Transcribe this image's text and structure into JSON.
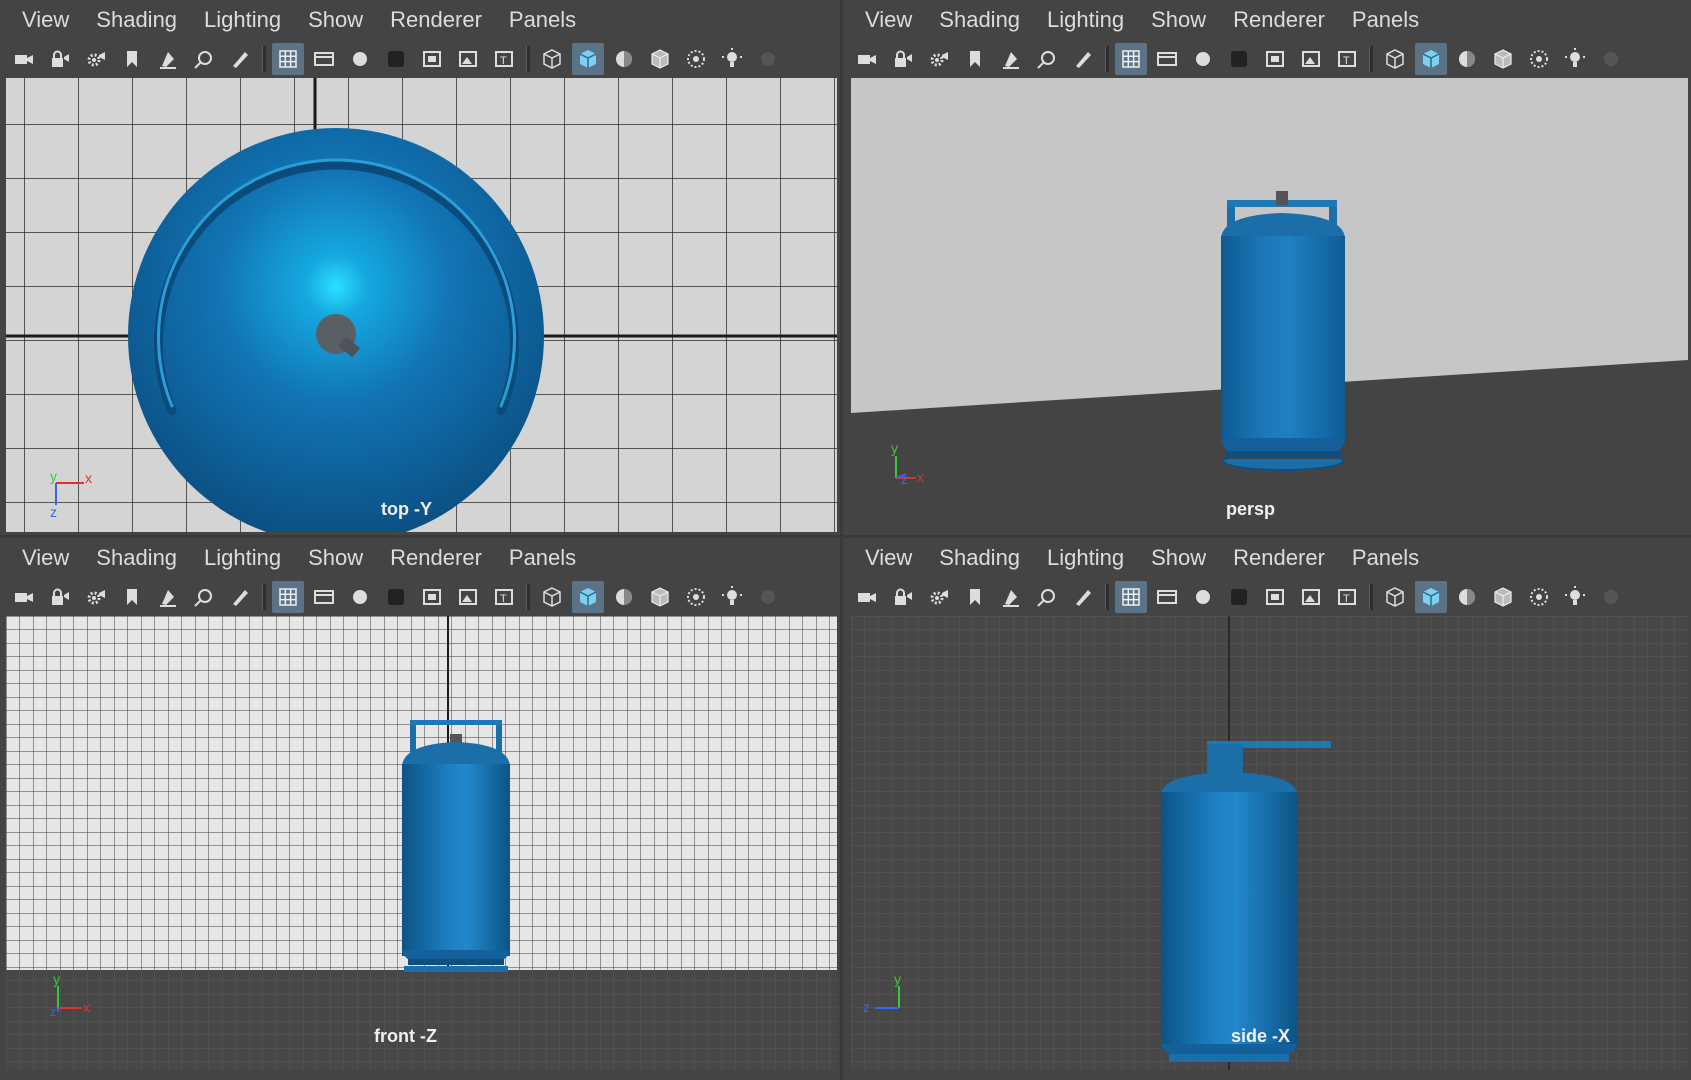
{
  "menus": [
    "View",
    "Shading",
    "Lighting",
    "Show",
    "Renderer",
    "Panels"
  ],
  "toolbar_icons": [
    "camera-icon",
    "lock-camera-icon",
    "camera-attributes-icon",
    "bookmark-icon",
    "image-plane-icon",
    "2d-pan-zoom-icon",
    "grease-pencil-icon",
    "|",
    "grid-icon",
    "film-gate-icon",
    "resolution-gate-icon",
    "gate-mask-icon",
    "field-chart-icon",
    "safe-action-icon",
    "safe-title-icon",
    "|",
    "wireframe-icon",
    "smooth-shade-icon",
    "use-default-material-icon",
    "wireframe-on-shaded-icon",
    "xray-icon",
    "use-all-lights-icon",
    "shadows-icon"
  ],
  "active_icons": [
    "grid-icon",
    "smooth-shade-icon"
  ],
  "colors": {
    "ui_bg": "#444444",
    "menu_text": "#dcdcdc",
    "active_button": "#5c7286",
    "object_blue": "#1b6ea8",
    "grid_light_bg": "#d4d4d4",
    "grid_dark_bg": "#474747",
    "axis_x": "#e0322c",
    "axis_y": "#3cc83c",
    "axis_z": "#3a66e8"
  },
  "viewports": {
    "top": {
      "label": "top -Y",
      "axis": {
        "a": "y",
        "b": "x",
        "c": "z"
      }
    },
    "persp": {
      "label": "persp",
      "axis": {
        "a": "y",
        "b": "x",
        "c": "z"
      }
    },
    "front": {
      "label": "front -Z",
      "axis": {
        "a": "y",
        "b": "x",
        "c": "z"
      }
    },
    "side": {
      "label": "side -X",
      "axis": {
        "a": "y",
        "b": "z",
        "c": ""
      }
    }
  }
}
